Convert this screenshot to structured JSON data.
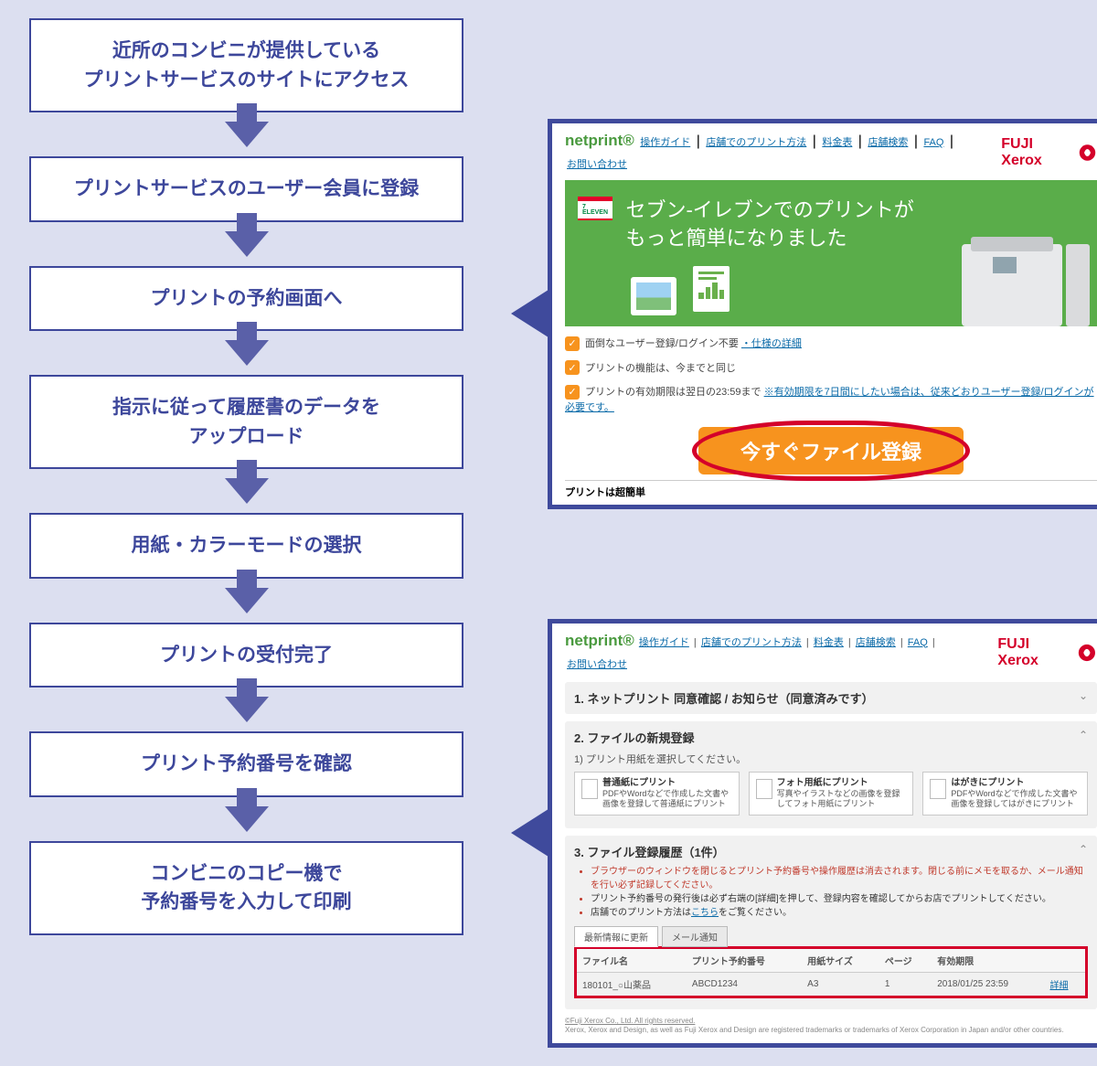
{
  "steps": [
    "近所のコンビニが提供している\nプリントサービスのサイトにアクセス",
    "プリントサービスのユーザー会員に登録",
    "プリントの予約画面へ",
    "指示に従って履歴書のデータを\nアップロード",
    "用紙・カラーモードの選択",
    "プリントの受付完了",
    "プリント予約番号を確認",
    "コンビニのコピー機で\n予約番号を入力して印刷"
  ],
  "screenshot1": {
    "logo": "netprint®",
    "brand": "FUJI Xerox",
    "topnav": [
      "操作ガイド",
      "店舗でのプリント方法",
      "料金表",
      "店舗検索",
      "FAQ",
      "お問い合わせ"
    ],
    "hero_title": "セブン‐イレブンでのプリントが\nもっと簡単になりました",
    "checks": [
      {
        "text": "面倒なユーザー登録/ログイン不要",
        "link": "・仕様の詳細"
      },
      {
        "text": "プリントの機能は、今までと同じ",
        "link": ""
      },
      {
        "text": "プリントの有効期限は翌日の23:59まで",
        "link": "※有効期限を7日間にしたい場合は、従来どおりユーザー登録/ログインが必要です。"
      }
    ],
    "cta": "今すぐファイル登録",
    "foot": "プリントは超簡単"
  },
  "screenshot2": {
    "logo": "netprint®",
    "brand": "FUJI Xerox",
    "topnav": [
      "操作ガイド",
      "店舗でのプリント方法",
      "料金表",
      "店舗検索",
      "FAQ",
      "お問い合わせ"
    ],
    "sec1": "1. ネットプリント 同意確認 / お知らせ（同意済みです）",
    "sec2": "2. ファイルの新規登録",
    "sec2_sub": "1) プリント用紙を選択してください。",
    "paper_buttons": [
      {
        "title": "普通紙にプリント",
        "desc": "PDFやWordなどで作成した文書や画像を登録して普通紙にプリント"
      },
      {
        "title": "フォト用紙にプリント",
        "desc": "写真やイラストなどの画像を登録してフォト用紙にプリント"
      },
      {
        "title": "はがきにプリント",
        "desc": "PDFやWordなどで作成した文書や画像を登録してはがきにプリント"
      }
    ],
    "sec3": "3. ファイル登録履歴（1件）",
    "sec3_bullets": [
      "ブラウザーのウィンドウを閉じるとプリント予約番号や操作履歴は消去されます。閉じる前にメモを取るか、メール通知を行い必ず記録してください。",
      "プリント予約番号の発行後は必ず右端の[詳細]を押して、登録内容を確認してからお店でプリントしてください。",
      "店舗でのプリント方法はこちらをご覧ください。"
    ],
    "link_word": "こちら",
    "tabs": [
      "最新情報に更新",
      "メール通知"
    ],
    "table": {
      "headers": [
        "ファイル名",
        "プリント予約番号",
        "用紙サイズ",
        "ページ",
        "有効期限",
        ""
      ],
      "row": [
        "180101_○山薬品",
        "ABCD1234",
        "A3",
        "1",
        "2018/01/25 23:59",
        "詳細"
      ]
    },
    "copyright1": "©Fuji Xerox Co., Ltd.  All rights reserved.",
    "copyright2": "Xerox, Xerox and Design, as well as Fuji Xerox and Design are registered trademarks or trademarks of Xerox Corporation in Japan and/or other countries."
  }
}
